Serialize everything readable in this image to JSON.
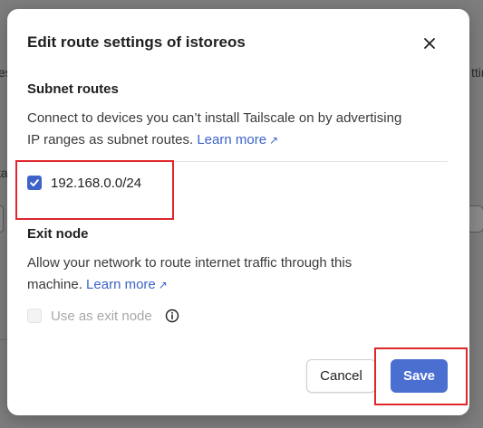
{
  "background": {
    "frag_left": "es",
    "frag_right": "ttin",
    "frag_left2": "ta"
  },
  "dialog": {
    "title": "Edit route settings of istoreos",
    "close_icon": "close-icon"
  },
  "subnet": {
    "heading": "Subnet routes",
    "description_line1": "Connect to devices you can’t install Tailscale on by advertising",
    "description_line2": "IP ranges as subnet routes.",
    "learn_more": "Learn more",
    "routes": [
      {
        "label": "192.168.0.0/24",
        "checked": true
      }
    ]
  },
  "exit_node": {
    "heading": "Exit node",
    "description_line1": "Allow your network to route internet traffic through this",
    "description_line2": "machine.",
    "learn_more": "Learn more",
    "option_label": "Use as exit node",
    "option_checked": false,
    "option_disabled": true,
    "info_icon": "info-icon"
  },
  "actions": {
    "cancel": "Cancel",
    "save": "Save"
  },
  "colors": {
    "accent": "#4a6fd1",
    "link": "#3d63c9",
    "highlight": "#e0262b",
    "overlay": "#7d7d7d"
  }
}
